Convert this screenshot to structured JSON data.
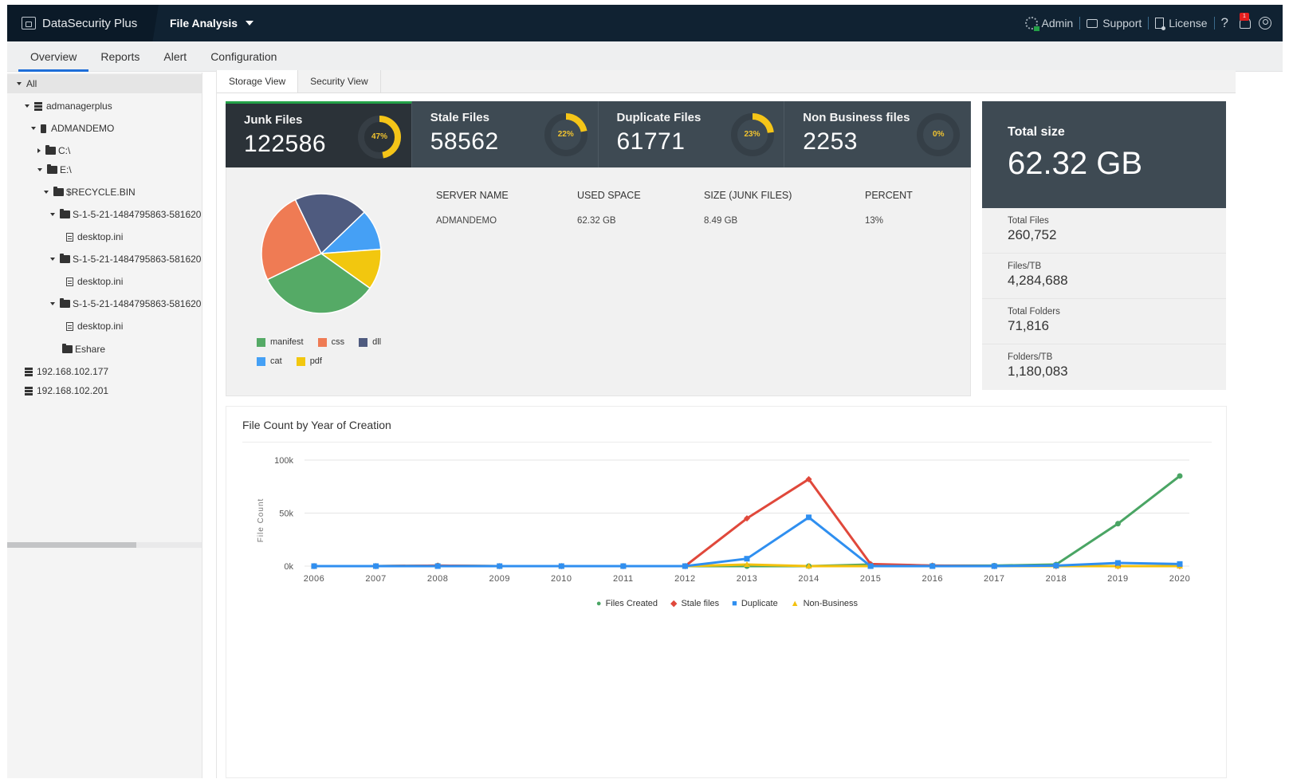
{
  "app": {
    "brand": "DataSecurity Plus",
    "module": "File Analysis"
  },
  "topbar": {
    "admin": "Admin",
    "support": "Support",
    "license": "License",
    "help": "?",
    "notifications": "1"
  },
  "subnav": [
    {
      "label": "Overview",
      "active": true
    },
    {
      "label": "Reports",
      "active": false
    },
    {
      "label": "Alert",
      "active": false
    },
    {
      "label": "Configuration",
      "active": false
    }
  ],
  "tree": [
    {
      "label": "All",
      "level": 0,
      "toggle": "down",
      "icon": "none",
      "selected": true
    },
    {
      "label": "admanagerplus",
      "level": 1,
      "toggle": "down",
      "icon": "server"
    },
    {
      "label": "ADMANDEMO",
      "level": 2,
      "toggle": "down",
      "icon": "computer"
    },
    {
      "label": "C:\\",
      "level": 3,
      "toggle": "right",
      "icon": "folder"
    },
    {
      "label": "E:\\",
      "level": 3,
      "toggle": "down",
      "icon": "folder"
    },
    {
      "label": "$RECYCLE.BIN",
      "level": 4,
      "toggle": "down",
      "icon": "folder"
    },
    {
      "label": "S-1-5-21-1484795863-581620",
      "level": 5,
      "toggle": "down",
      "icon": "folder"
    },
    {
      "label": "desktop.ini",
      "level": 6,
      "toggle": "none",
      "icon": "file"
    },
    {
      "label": "S-1-5-21-1484795863-581620",
      "level": 5,
      "toggle": "down",
      "icon": "folder"
    },
    {
      "label": "desktop.ini",
      "level": 6,
      "toggle": "none",
      "icon": "file"
    },
    {
      "label": "S-1-5-21-1484795863-581620",
      "level": 5,
      "toggle": "down",
      "icon": "folder"
    },
    {
      "label": "desktop.ini",
      "level": 6,
      "toggle": "none",
      "icon": "file"
    },
    {
      "label": "Eshare",
      "level": 4,
      "toggle": "none",
      "icon": "folder"
    },
    {
      "label": "192.168.102.177",
      "level": 1,
      "toggle": "none",
      "icon": "server"
    },
    {
      "label": "192.168.102.201",
      "level": 1,
      "toggle": "none",
      "icon": "server"
    }
  ],
  "view_tabs": [
    {
      "label": "Storage View",
      "active": true
    },
    {
      "label": "Security View",
      "active": false
    }
  ],
  "kpis": [
    {
      "title": "Junk Files",
      "value": "122586",
      "percent": 47,
      "percent_label": "47%",
      "active": true
    },
    {
      "title": "Stale Files",
      "value": "58562",
      "percent": 22,
      "percent_label": "22%",
      "active": false
    },
    {
      "title": "Duplicate Files",
      "value": "61771",
      "percent": 23,
      "percent_label": "23%",
      "active": false
    },
    {
      "title": "Non Business files",
      "value": "2253",
      "percent": 0,
      "percent_label": "0%",
      "active": false
    }
  ],
  "colors": {
    "accent_green": "#24a148",
    "donut": "#f5c518",
    "tab_underline": "#1e6ed8"
  },
  "pie": {
    "slices": [
      {
        "label": "manifest",
        "value": 33,
        "color": "#55aa66"
      },
      {
        "label": "css",
        "value": 25,
        "color": "#ef7b54"
      },
      {
        "label": "dll",
        "value": 20,
        "color": "#4f5b7f"
      },
      {
        "label": "cat",
        "value": 11,
        "color": "#45a0f5"
      },
      {
        "label": "pdf",
        "value": 11,
        "color": "#f2c70f"
      }
    ]
  },
  "server_table": {
    "headers": [
      "SERVER NAME",
      "USED SPACE",
      "SIZE (JUNK FILES)",
      "PERCENT"
    ],
    "rows": [
      [
        "ADMANDEMO",
        "62.32 GB",
        "8.49 GB",
        "13%"
      ]
    ]
  },
  "totals": {
    "title": "Total size",
    "value": "62.32 GB",
    "items": [
      {
        "label": "Total Files",
        "value": "260,752"
      },
      {
        "label": "Files/TB",
        "value": "4,284,688"
      },
      {
        "label": "Total Folders",
        "value": "71,816"
      },
      {
        "label": "Folders/TB",
        "value": "1,180,083"
      }
    ]
  },
  "chart_data": {
    "type": "line",
    "title": "File Count by Year of Creation",
    "xlabel": "",
    "ylabel": "File Count",
    "x": [
      "2006",
      "2007",
      "2008",
      "2009",
      "2010",
      "2011",
      "2012",
      "2013",
      "2014",
      "2015",
      "2016",
      "2017",
      "2018",
      "2019",
      "2020"
    ],
    "ylim": [
      0,
      100000
    ],
    "yticks": [
      "0k",
      "50k",
      "100k"
    ],
    "ytick_values": [
      0,
      50000,
      100000
    ],
    "grid": true,
    "legend_position": "bottom",
    "series": [
      {
        "name": "Files Created",
        "color": "#4aa564",
        "marker": "circle",
        "values": [
          0,
          0,
          500,
          0,
          0,
          0,
          0,
          0,
          0,
          1500,
          500,
          500,
          1500,
          40000,
          85000
        ]
      },
      {
        "name": "Stale files",
        "color": "#e0483b",
        "marker": "diamond",
        "values": [
          0,
          0,
          500,
          0,
          0,
          0,
          0,
          45000,
          82000,
          2000,
          500,
          0,
          0,
          0,
          0
        ]
      },
      {
        "name": "Duplicate",
        "color": "#2f8ff0",
        "marker": "square",
        "values": [
          0,
          0,
          0,
          0,
          0,
          0,
          0,
          7000,
          46000,
          0,
          0,
          0,
          500,
          3000,
          2000
        ]
      },
      {
        "name": "Non-Business",
        "color": "#f4c10e",
        "marker": "triangle",
        "values": [
          0,
          0,
          0,
          0,
          0,
          0,
          0,
          1500,
          0,
          0,
          0,
          0,
          0,
          0,
          0
        ]
      }
    ]
  }
}
